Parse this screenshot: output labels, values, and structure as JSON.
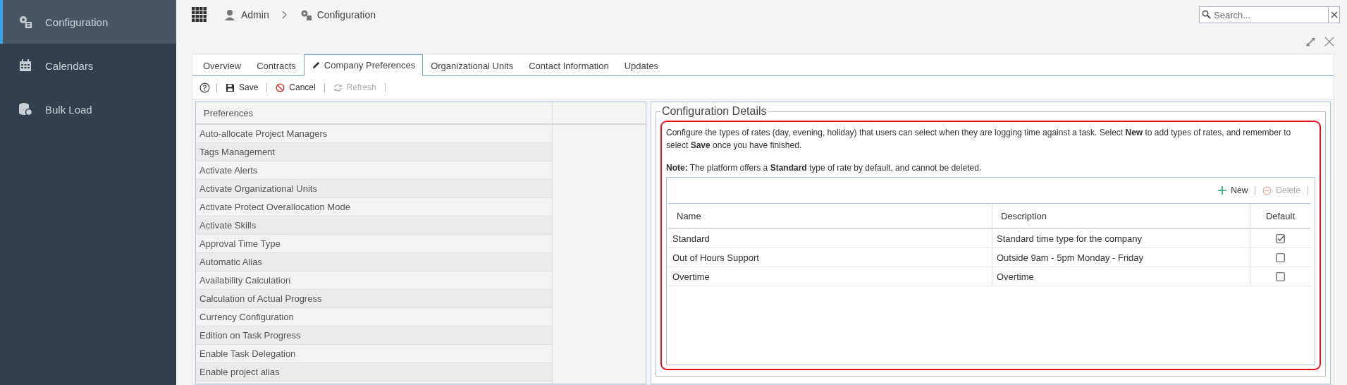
{
  "sidebar": {
    "items": [
      {
        "label": "Configuration",
        "kind": "config",
        "selected": true
      },
      {
        "label": "Calendars",
        "kind": "calendar",
        "selected": false
      },
      {
        "label": "Bulk Load",
        "kind": "database",
        "selected": false
      }
    ]
  },
  "breadcrumb": [
    {
      "label": "Admin",
      "kind": "user"
    },
    {
      "label": "Configuration",
      "kind": "config"
    }
  ],
  "search": {
    "placeholder": "Search..."
  },
  "tabs": [
    {
      "label": "Overview",
      "selected": false
    },
    {
      "label": "Contracts",
      "selected": false
    },
    {
      "label": "Company Preferences",
      "selected": true
    },
    {
      "label": "Organizational Units",
      "selected": false
    },
    {
      "label": "Contact Information",
      "selected": false
    },
    {
      "label": "Updates",
      "selected": false
    }
  ],
  "toolbar": [
    {
      "label": "Save",
      "kind": "save",
      "disabled": false
    },
    {
      "label": "Cancel",
      "kind": "cancel",
      "disabled": false
    },
    {
      "label": "Refresh",
      "kind": "refresh",
      "disabled": true
    }
  ],
  "preferences": {
    "column": "Preferences",
    "items": [
      "Auto-allocate Project Managers",
      "Tags Management",
      "Activate Alerts",
      "Activate Organizational Units",
      "Activate Protect Overallocation Mode",
      "Activate Skills",
      "Approval Time Type",
      "Automatic Alias",
      "Availability Calculation",
      "Calculation of Actual Progress",
      "Currency Configuration",
      "Edition on Task Progress",
      "Enable Task Delegation",
      "Enable project alias"
    ]
  },
  "details": {
    "title": "Configuration Details",
    "description": "Configure the types of rates (day, evening, holiday) that users can select when they are logging time against a task. Select **New** to add types of rates, and remember to select **Save** once you have finished.",
    "note": "**Note:** The platform offers a **Standard** type of rate by default, and cannot be deleted.",
    "grid_toolbar": [
      {
        "label": "New",
        "kind": "add",
        "disabled": false
      },
      {
        "label": "Delete",
        "kind": "delete",
        "disabled": true
      }
    ],
    "columns": [
      "Name",
      "Description",
      "Default"
    ],
    "rows": [
      {
        "name": "Standard",
        "description": "Standard time type for the company",
        "checked": true
      },
      {
        "name": "Out of Hours Support",
        "description": "Outside 9am - 5pm Monday - Friday",
        "checked": false
      },
      {
        "name": "Overtime",
        "description": "Overtime",
        "checked": false
      }
    ]
  }
}
